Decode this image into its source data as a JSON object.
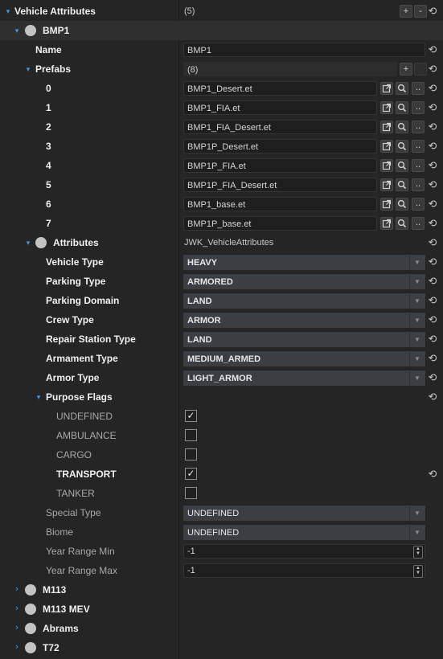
{
  "root": {
    "label": "Vehicle Attributes",
    "count": "(5)",
    "add_label": "+",
    "remove_label": "-",
    "revert_glyph": "⟲"
  },
  "bmp1": {
    "label": "BMP1",
    "name_label": "Name",
    "name_value": "BMP1",
    "prefabs_label": "Prefabs",
    "prefabs_count": "(8)",
    "prefabs": [
      {
        "index": "0",
        "value": "BMP1_Desert.et"
      },
      {
        "index": "1",
        "value": "BMP1_FIA.et"
      },
      {
        "index": "2",
        "value": "BMP1_FIA_Desert.et"
      },
      {
        "index": "3",
        "value": "BMP1P_Desert.et"
      },
      {
        "index": "4",
        "value": "BMP1P_FIA.et"
      },
      {
        "index": "5",
        "value": "BMP1P_FIA_Desert.et"
      },
      {
        "index": "6",
        "value": "BMP1_base.et"
      },
      {
        "index": "7",
        "value": "BMP1P_base.et"
      }
    ],
    "attributes_label": "Attributes",
    "attributes_class": "JWK_VehicleAttributes",
    "combos": [
      {
        "label": "Vehicle Type",
        "value": "HEAVY"
      },
      {
        "label": "Parking Type",
        "value": "ARMORED"
      },
      {
        "label": "Parking Domain",
        "value": "LAND"
      },
      {
        "label": "Crew Type",
        "value": "ARMOR"
      },
      {
        "label": "Repair Station Type",
        "value": "LAND"
      },
      {
        "label": "Armament Type",
        "value": "MEDIUM_ARMED"
      },
      {
        "label": "Armor Type",
        "value": "LIGHT_ARMOR"
      }
    ],
    "purpose_label": "Purpose Flags",
    "flags": [
      {
        "label": "UNDEFINED",
        "checked": true
      },
      {
        "label": "AMBULANCE",
        "checked": false
      },
      {
        "label": "CARGO",
        "checked": false
      },
      {
        "label": "TRANSPORT",
        "checked": true
      },
      {
        "label": "TANKER",
        "checked": false
      }
    ],
    "special_type_label": "Special Type",
    "special_type_value": "UNDEFINED",
    "biome_label": "Biome",
    "biome_value": "UNDEFINED",
    "year_min_label": "Year Range Min",
    "year_min_value": "-1",
    "year_max_label": "Year Range Max",
    "year_max_value": "-1"
  },
  "others": [
    "M113",
    "M113 MEV",
    "Abrams",
    "T72"
  ],
  "glyphs": {
    "open_arrow": "▾",
    "closed_arrow": "›",
    "check": "✓",
    "caret": "▼",
    "spin_up": "▲",
    "spin_down": "▼",
    "dots": ".."
  },
  "colors": {
    "background": "#252526",
    "accent_arrow": "#3d9be9",
    "combo_bg": "#3b3f43"
  }
}
